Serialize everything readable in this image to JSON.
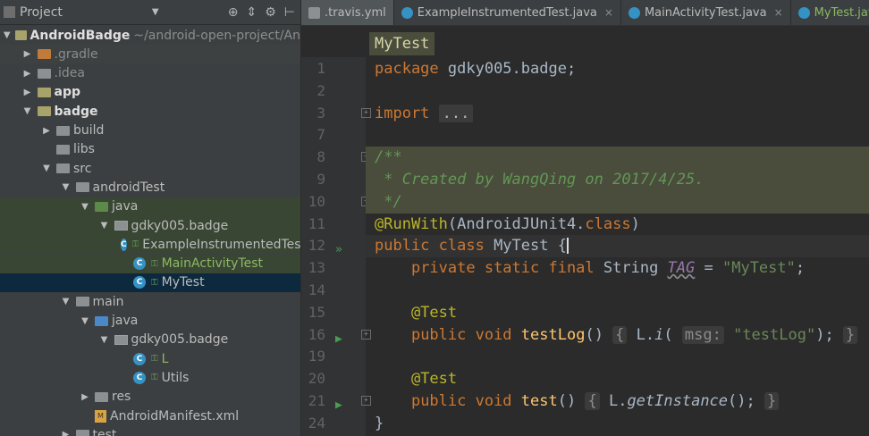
{
  "project_panel": {
    "title": "Project",
    "tools": [
      "⊕",
      "⇕",
      "⚙",
      "⊢"
    ],
    "tree": [
      {
        "label": "AndroidBadge",
        "extra": "~/android-open-project/An",
        "level": 0,
        "arrow": "▼",
        "icon": "module",
        "style": "bold"
      },
      {
        "label": ".gradle",
        "level": 1,
        "arrow": "▶",
        "icon": "folder-orange",
        "style": "dim",
        "hl": "gray"
      },
      {
        "label": ".idea",
        "level": 1,
        "arrow": "▶",
        "icon": "folder",
        "style": "dim"
      },
      {
        "label": "app",
        "level": 1,
        "arrow": "▶",
        "icon": "module",
        "style": "bold"
      },
      {
        "label": "badge",
        "level": 1,
        "arrow": "▼",
        "icon": "module",
        "style": "bold"
      },
      {
        "label": "build",
        "level": 2,
        "arrow": "▶",
        "icon": "folder",
        "style": ""
      },
      {
        "label": "libs",
        "level": 2,
        "arrow": "",
        "icon": "folder",
        "style": ""
      },
      {
        "label": "src",
        "level": 2,
        "arrow": "▼",
        "icon": "folder",
        "style": ""
      },
      {
        "label": "androidTest",
        "level": 3,
        "arrow": "▼",
        "icon": "folder",
        "style": ""
      },
      {
        "label": "java",
        "level": 4,
        "arrow": "▼",
        "icon": "folder-green",
        "style": "",
        "hl": "green"
      },
      {
        "label": "gdky005.badge",
        "level": 5,
        "arrow": "▼",
        "icon": "package",
        "style": "",
        "hl": "green"
      },
      {
        "label": "ExampleInstrumentedTest",
        "level": 6,
        "arrow": "",
        "icon": "class",
        "style": "",
        "hl": "green"
      },
      {
        "label": "MainActivityTest",
        "level": 6,
        "arrow": "",
        "icon": "class",
        "style": "green",
        "hl": "green"
      },
      {
        "label": "MyTest",
        "level": 6,
        "arrow": "",
        "icon": "class",
        "style": "",
        "hl": "sel"
      },
      {
        "label": "main",
        "level": 3,
        "arrow": "▼",
        "icon": "folder",
        "style": ""
      },
      {
        "label": "java",
        "level": 4,
        "arrow": "▼",
        "icon": "folder-blue",
        "style": ""
      },
      {
        "label": "gdky005.badge",
        "level": 5,
        "arrow": "▼",
        "icon": "package",
        "style": ""
      },
      {
        "label": "L",
        "level": 6,
        "arrow": "",
        "icon": "class",
        "style": "green"
      },
      {
        "label": "Utils",
        "level": 6,
        "arrow": "",
        "icon": "class",
        "style": ""
      },
      {
        "label": "res",
        "level": 4,
        "arrow": "▶",
        "icon": "folder",
        "style": ""
      },
      {
        "label": "AndroidManifest.xml",
        "level": 4,
        "arrow": "",
        "icon": "xml",
        "style": ""
      },
      {
        "label": "test",
        "level": 3,
        "arrow": "▶",
        "icon": "folder",
        "style": ""
      }
    ]
  },
  "tabs": [
    {
      "label": ".travis.yml",
      "icon_color": "#8c9093",
      "active": true,
      "close": ""
    },
    {
      "label": "ExampleInstrumentedTest.java",
      "icon_color": "#3592c4",
      "active": false,
      "close": "×"
    },
    {
      "label": "MainActivityTest.java",
      "icon_color": "#3592c4",
      "active": false,
      "close": "×"
    },
    {
      "label": "MyTest.java",
      "icon_color": "#3592c4",
      "active": false,
      "close": "",
      "green": true
    }
  ],
  "breadcrumb": "MyTest",
  "editor": {
    "lines": [
      {
        "n": "1",
        "html": "<span class=\"kw\">package</span> gdky005.badge;"
      },
      {
        "n": "2",
        "html": ""
      },
      {
        "n": "3",
        "html": "<span class=\"kw\">import</span> <span class=\"fold-box\">...</span>",
        "fold": true
      },
      {
        "n": "7",
        "html": ""
      },
      {
        "n": "8",
        "html": "<span class=\"doccm\">/**</span>",
        "doc": true,
        "fold": true
      },
      {
        "n": "9",
        "html": "<span class=\"doccm\"> * Created by WangQing on 2017/4/25.</span>",
        "doc": true
      },
      {
        "n": "10",
        "html": "<span class=\"doccm\"> */</span>",
        "doc": true,
        "fold": true
      },
      {
        "n": "11",
        "html": "<span class=\"ann\">@RunWith</span>(AndroidJUnit4.<span class=\"kw\">class</span>)"
      },
      {
        "n": "12",
        "html": "<span class=\"kw\">public class</span> MyTest {<span class=\"caret\"></span>",
        "run": "»",
        "cur": true
      },
      {
        "n": "13",
        "html": "    <span class=\"kw\">private static final</span> String <span class=\"fld\">TAG</span> = <span class=\"str\">\"MyTest\"</span>;"
      },
      {
        "n": "14",
        "html": ""
      },
      {
        "n": "15",
        "html": "    <span class=\"ann\">@Test</span>"
      },
      {
        "n": "16",
        "html": "    <span class=\"kw\">public void</span> <span class=\"fn\">testLog</span>() <span class=\"hint\">{</span> L.<span class=\"it\">i</span>( <span class=\"hint\">msg:</span> <span class=\"str\">\"testLog\"</span>); <span class=\"hint\">}</span>",
        "run": "▶",
        "fold": true
      },
      {
        "n": "19",
        "html": ""
      },
      {
        "n": "20",
        "html": "    <span class=\"ann\">@Test</span>"
      },
      {
        "n": "21",
        "html": "    <span class=\"kw\">public void</span> <span class=\"fn\">test</span>() <span class=\"hint\">{</span> L.<span class=\"it\">getInstance</span>(); <span class=\"hint\">}</span>",
        "run": "▶",
        "fold": true
      },
      {
        "n": "24",
        "html": "}"
      }
    ]
  }
}
